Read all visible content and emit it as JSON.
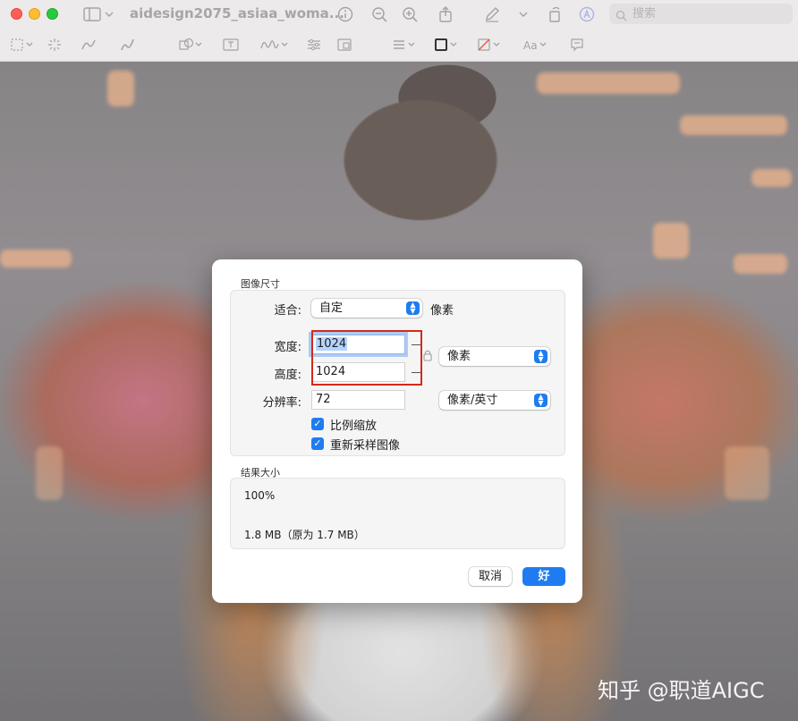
{
  "window": {
    "title": "aidesign2075_asiaa_woma...",
    "search_placeholder": "搜索"
  },
  "dialog": {
    "image_size_title": "图像尺寸",
    "fit_label": "适合:",
    "fit_value": "自定",
    "fit_unit": "像素",
    "width_label": "宽度:",
    "width_value": "1024",
    "height_label": "高度:",
    "height_value": "1024",
    "size_unit": "像素",
    "resolution_label": "分辨率:",
    "resolution_value": "72",
    "resolution_unit": "像素/英寸",
    "scale_proportionally_label": "比例缩放",
    "scale_proportionally_checked": true,
    "resample_label": "重新采样图像",
    "resample_checked": true,
    "result_title": "结果大小",
    "result_percent": "100%",
    "result_size": "1.8 MB（原为 1.7 MB）",
    "cancel_label": "取消",
    "ok_label": "好"
  },
  "watermark": "知乎 @职道AIGC",
  "colors": {
    "accent": "#1f7cf0",
    "highlight_box": "#d42a1a"
  }
}
